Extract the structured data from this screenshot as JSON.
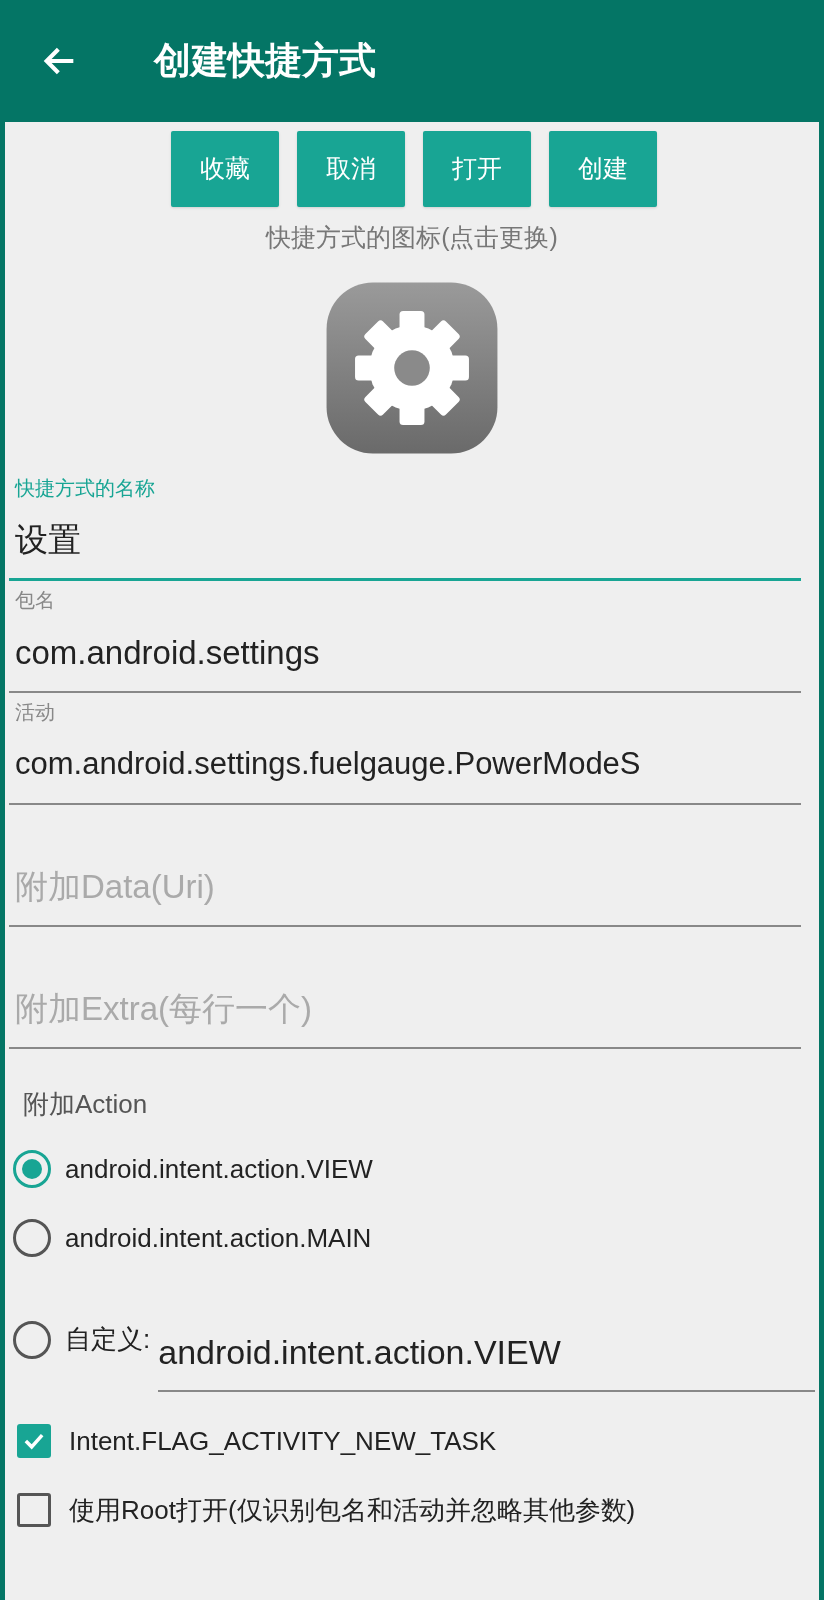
{
  "app_bar": {
    "title": "创建快捷方式"
  },
  "buttons": [
    {
      "label": "收藏"
    },
    {
      "label": "取消"
    },
    {
      "label": "打开"
    },
    {
      "label": "创建"
    }
  ],
  "icon_hint": "快捷方式的图标(点击更换)",
  "fields": [
    {
      "label": "快捷方式的名称",
      "value": "设置",
      "focused": true
    },
    {
      "label": "包名",
      "value": "com.android.settings",
      "focused": false
    },
    {
      "label": "活动",
      "value": "com.android.settings.fuelgauge.PowerModeS",
      "focused": false
    },
    {
      "placeholder": "附加Data(Uri)",
      "focused": false
    },
    {
      "placeholder": "附加Extra(每行一个)",
      "focused": false
    }
  ],
  "action": {
    "heading": "附加Action",
    "options": [
      {
        "label": "android.intent.action.VIEW",
        "selected": true
      },
      {
        "label": "android.intent.action.MAIN",
        "selected": false
      }
    ],
    "custom": {
      "label": "自定义:",
      "value": "android.intent.action.VIEW",
      "selected": false
    }
  },
  "checkboxes": [
    {
      "label": "Intent.FLAG_ACTIVITY_NEW_TASK",
      "checked": true
    },
    {
      "label": "使用Root打开(仅识别包名和活动并忽略其他参数)",
      "checked": false
    }
  ]
}
